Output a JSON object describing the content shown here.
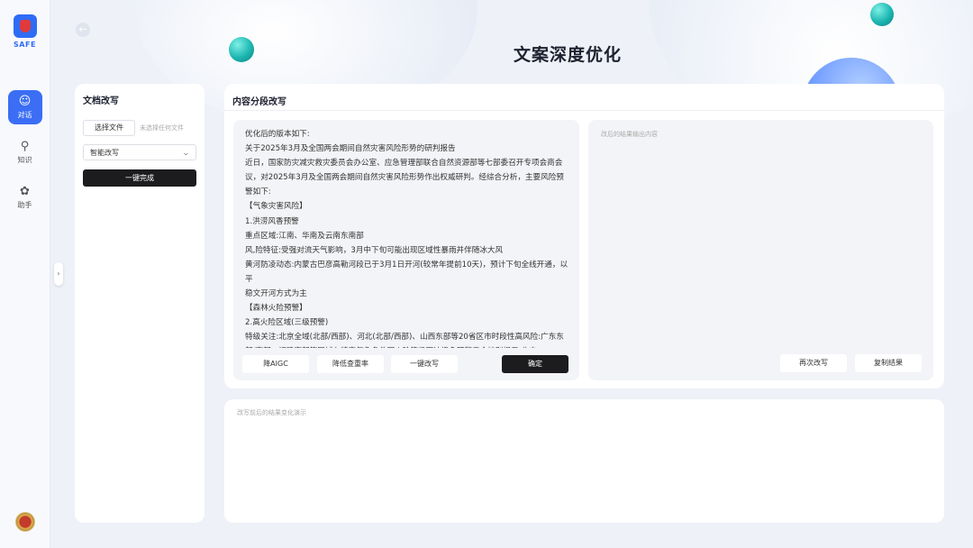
{
  "app": {
    "logo_text": "SAFE",
    "page_title": "文案深度优化"
  },
  "nav": {
    "items": [
      {
        "label": "对话",
        "icon": "chat-icon",
        "active": true
      },
      {
        "label": "知识",
        "icon": "knowledge-icon",
        "active": false
      },
      {
        "label": "助手",
        "icon": "assistant-icon",
        "active": false
      }
    ]
  },
  "doc_panel": {
    "title": "文档改写",
    "choose_file_label": "选择文件",
    "file_status": "未选择任何文件",
    "mode_selected": "智能改写",
    "one_click_label": "一键完成"
  },
  "main": {
    "title": "内容分段改写",
    "content_lines": [
      "优化后的版本如下:",
      "关于2025年3月及全国两会期间自然灾害风险形势的研判报告",
      "近日，国家防灾减灾救灾委员会办公室、应急管理部联合自然资源部等七部委召开专项会商会议，对2025年3月及全国两会期间自然灾害风险形势作出权威研判。经综合分析，主要风险预警如下:",
      "【气象灾害风险】",
      "1.洪涝风香预警",
      "重点区域:江南、华南及云南东南部",
      "风,险特征:受强对流天气影响，3月中下旬可能出现区域性暴雨并伴随冰大风",
      "黄河防凌动态:内蒙古巴彦高勒河段已于3月1日开河(较常年提前10天)，预计下旬全线开通，以平",
      "稳文开河方式为主",
      "【森林火险预警】",
      "2.高火险区域(三级预警)",
      "特级关注:北京全域(北部/西部)、河北(北部/西部)、山西东部等20省区市时段性高风险:广东东部/南部、福建南部等区域在特定气象条件下火险等级可达橙色预警需会持别提示:北京"
    ],
    "buttons": {
      "reduce_aigc": "降AIGC",
      "reduce_dup": "降低查重率",
      "one_key_rewrite": "一键改写",
      "confirm": "确定",
      "rewrite_again": "再次改写",
      "copy_result": "复制结果"
    },
    "output_placeholder": "改后的结果输出内容"
  },
  "compare": {
    "placeholder": "改写前后的结果变化演示"
  }
}
